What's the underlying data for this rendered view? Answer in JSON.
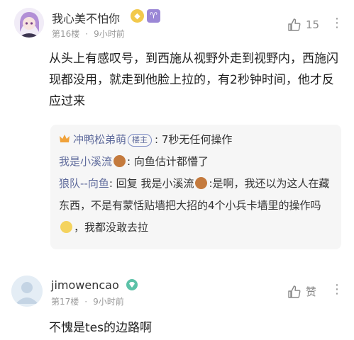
{
  "post1": {
    "username": "我心美不怕你",
    "floor": "第16楼",
    "time": "9小时前",
    "likes": "15",
    "body": "从头上有感叹号，到西施从视野外走到视野内，西施闪现都没用，就走到他脸上拉的，有2秒钟时间，他才反应过来",
    "replies": [
      {
        "name": "冲鸭松弟萌",
        "tag": "楼主",
        "text": "7秒无任何操作"
      },
      {
        "name": "我是小溪流",
        "text": "向鱼估计都懵了"
      },
      {
        "name": "狼队--向鱼",
        "reply_word": "回复",
        "reply_to": "我是小溪流",
        "text_a": ":是啊，我还以为这人在藏东西，不是有蒙恬贴墙把大招的4个小兵卡墙里的操作吗",
        "text_b": "，我都没敢去拉"
      }
    ]
  },
  "post2": {
    "username": "jimowencao",
    "floor": "第17楼",
    "time": "9小时前",
    "like_label": "赞",
    "body": "不愧是tes的边路啊"
  }
}
